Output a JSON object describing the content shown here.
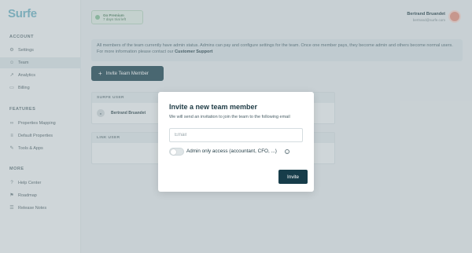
{
  "app": {
    "logo": "Surfe"
  },
  "sidebar": {
    "sections": [
      {
        "title": "ACCOUNT",
        "items": [
          {
            "label": "Settings",
            "icon": "gear-icon"
          },
          {
            "label": "Team",
            "icon": "users-icon",
            "active": true
          },
          {
            "label": "Analytics",
            "icon": "chart-icon"
          },
          {
            "label": "Billing",
            "icon": "card-icon"
          }
        ]
      },
      {
        "title": "FEATURES",
        "items": [
          {
            "label": "Properties Mapping",
            "icon": "link-icon"
          },
          {
            "label": "Default Properties",
            "icon": "list-icon"
          },
          {
            "label": "Tools & Apps",
            "icon": "wrench-icon"
          }
        ]
      },
      {
        "title": "MORE",
        "items": [
          {
            "label": "Help Center",
            "icon": "help-icon"
          },
          {
            "label": "Roadmap",
            "icon": "map-icon"
          },
          {
            "label": "Release Notes",
            "icon": "notes-icon"
          }
        ]
      }
    ]
  },
  "header": {
    "promo_title": "Go Premium",
    "promo_subtitle": "7 days trial left",
    "user_name": "Bertrand Bruandet",
    "user_email": "bertrand@surfe.com"
  },
  "main": {
    "notice_text": "All members of the team currently have admin status. Admins can pay and configure settings for the team. Once one member pays, they become admin and others become normal users. For more information please contact our",
    "notice_link": "Customer Support",
    "invite_button": "Invite Team Member",
    "surfe_users_header": "SURFE USER",
    "surfe_user_row": "Bertrand Bruandet",
    "link_users_header": "LINK USER"
  },
  "modal": {
    "title": "Invite a new team member",
    "description": "We will send an invitation to join the team to the following email",
    "email_placeholder": "Email",
    "email_value": "",
    "admin_toggle_label": "Admin only access (accountant, CFO, ...)",
    "admin_toggle_on": false,
    "invite_label": "Invite"
  },
  "colors": {
    "primary": "#173d4a",
    "accent": "#6fb4c6",
    "avatar": "#e7927e"
  }
}
